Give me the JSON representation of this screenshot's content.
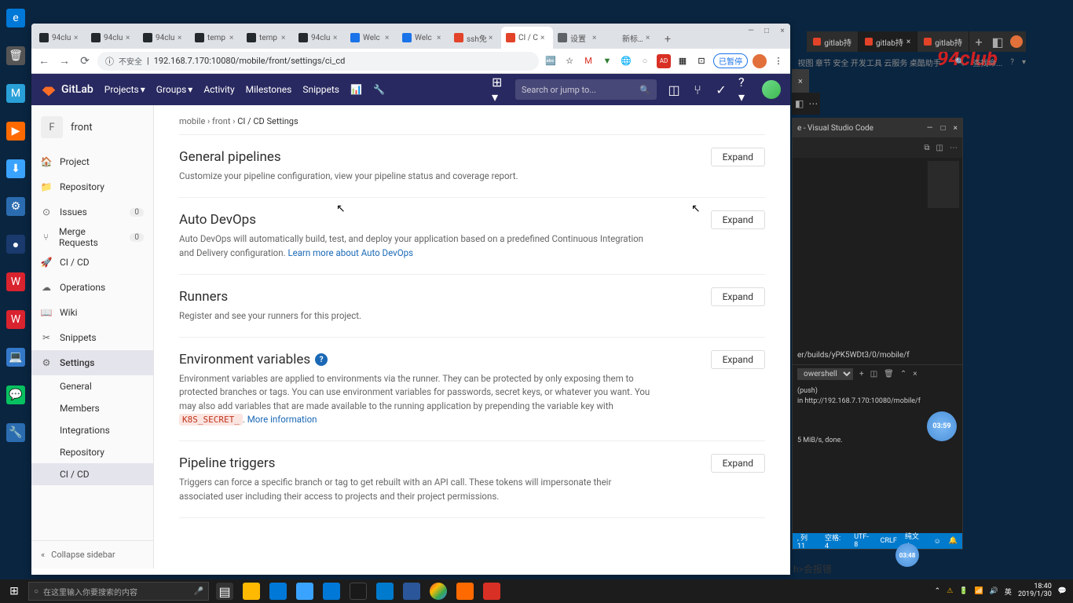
{
  "desktop": {
    "icons": [
      "Microsoft Edge",
      "回收站",
      "MuMu模拟器",
      "影音先锋",
      "迅雷",
      "驱动精灵",
      "EV录屏",
      "WPS H",
      "WPS 20",
      "此电脑",
      "微信",
      "系统修复"
    ]
  },
  "browser": {
    "controls": {
      "min": "—",
      "max": "□",
      "close": "×"
    },
    "tabs": [
      {
        "favicon": "#24292e",
        "label": "94clu"
      },
      {
        "favicon": "#24292e",
        "label": "94clu"
      },
      {
        "favicon": "#24292e",
        "label": "94clu"
      },
      {
        "favicon": "#24292e",
        "label": "temp"
      },
      {
        "favicon": "#24292e",
        "label": "temp"
      },
      {
        "favicon": "#24292e",
        "label": "94clu"
      },
      {
        "favicon": "#1a73e8",
        "label": "Welc"
      },
      {
        "favicon": "#1a73e8",
        "label": "Welc"
      },
      {
        "favicon": "#e24329",
        "label": "ssh免"
      },
      {
        "favicon": "#e24329",
        "label": "CI / C",
        "active": true
      },
      {
        "favicon": "#5f6368",
        "label": "设置"
      },
      {
        "favicon": "",
        "label": "新标签页"
      }
    ],
    "nav": {
      "back": "←",
      "forward": "→",
      "reload": "⟳"
    },
    "url_warn_icon": "ⓘ",
    "url_warn": "不安全",
    "url": "192.168.7.170:10080/mobile/front/settings/ci_cd",
    "pause_label": "已暂停"
  },
  "gitlab": {
    "logo": "GitLab",
    "nav": [
      "Projects",
      "Groups",
      "Activity",
      "Milestones",
      "Snippets"
    ],
    "search_placeholder": "Search or jump to...",
    "project": {
      "letter": "F",
      "name": "front"
    },
    "sidebar": {
      "items": [
        {
          "icon": "🏠",
          "label": "Project"
        },
        {
          "icon": "📁",
          "label": "Repository"
        },
        {
          "icon": "⊙",
          "label": "Issues",
          "badge": "0"
        },
        {
          "icon": "⑂",
          "label": "Merge Requests",
          "badge": "0"
        },
        {
          "icon": "🚀",
          "label": "CI / CD"
        },
        {
          "icon": "☁",
          "label": "Operations"
        },
        {
          "icon": "📖",
          "label": "Wiki"
        },
        {
          "icon": "✂",
          "label": "Snippets"
        },
        {
          "icon": "⚙",
          "label": "Settings",
          "active": true
        }
      ],
      "subs": [
        "General",
        "Members",
        "Integrations",
        "Repository",
        "CI / CD"
      ],
      "collapse": "Collapse sidebar"
    },
    "breadcrumb": {
      "p1": "mobile",
      "p2": "front",
      "p3": "CI / CD Settings"
    },
    "sections": [
      {
        "title": "General pipelines",
        "desc": "Customize your pipeline configuration, view your pipeline status and coverage report.",
        "expand": "Expand"
      },
      {
        "title": "Auto DevOps",
        "desc": "Auto DevOps will automatically build, test, and deploy your application based on a predefined Continuous Integration and Delivery configuration. ",
        "link": "Learn more about Auto DevOps",
        "expand": "Expand"
      },
      {
        "title": "Runners",
        "desc": "Register and see your runners for this project.",
        "expand": "Expand"
      },
      {
        "title": "Environment variables",
        "help": true,
        "desc": "Environment variables are applied to environments via the runner. They can be protected by only exposing them to protected branches or tags. You can use environment variables for passwords, secret keys, or whatever you want. You may also add variables that are made available to the running application by prepending the variable key with ",
        "code": "K8S_SECRET_",
        "desc2": ". ",
        "link": "More information",
        "expand": "Expand"
      },
      {
        "title": "Pipeline triggers",
        "desc": "Triggers can force a specific branch or tag to get rebuilt with an API call. These tokens will impersonate their associated user including their access to projects and their project permissions.",
        "expand": "Expand"
      }
    ]
  },
  "vscode": {
    "title": "e - Visual Studio Code",
    "terminal_panel": "owershell",
    "terminal_lines": [
      "er/builds/yPK5WDt3/0/mobile/f",
      "",
      "(push)",
      "in http://192.168.7.170:10080/mobile/f",
      "",
      "5 MiB/s, done."
    ],
    "status": {
      "col": ", 列 11",
      "spaces": "空格: 4",
      "enc": "UTF-8",
      "eol": "CRLF",
      "lang": "纯文本"
    }
  },
  "small_tabs": [
    "gitlab持",
    "gitlab持",
    "gitlab持"
  ],
  "right_toolbar": "视图 章节 安全 开发工具 云服务 桌酷助手",
  "right_search": "查找命...",
  "watermark": "94club",
  "timers": {
    "t1": "03:59",
    "t2": "03:48"
  },
  "bottom_error": "h>会报错",
  "taskbar": {
    "search_placeholder": "在这里输入你要搜索的内容",
    "time": "18:40",
    "date": "2019/1/30"
  }
}
